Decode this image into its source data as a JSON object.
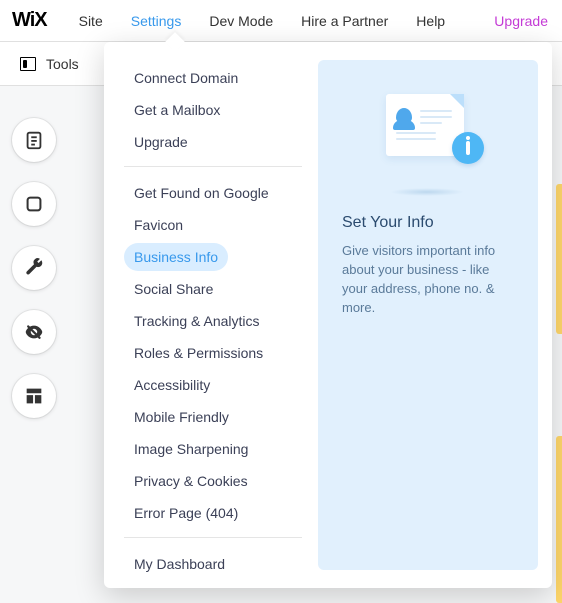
{
  "brand": "WiX",
  "topnav": {
    "site": "Site",
    "settings": "Settings",
    "devmode": "Dev Mode",
    "hire": "Hire a Partner",
    "help": "Help",
    "upgrade": "Upgrade"
  },
  "toolsbar": {
    "label": "Tools"
  },
  "settings_menu": {
    "group1": [
      {
        "key": "connect_domain",
        "label": "Connect Domain"
      },
      {
        "key": "get_mailbox",
        "label": "Get a Mailbox"
      },
      {
        "key": "upgrade",
        "label": "Upgrade"
      }
    ],
    "group2": [
      {
        "key": "get_found",
        "label": "Get Found on Google"
      },
      {
        "key": "favicon",
        "label": "Favicon"
      },
      {
        "key": "business_info",
        "label": "Business Info",
        "selected": true
      },
      {
        "key": "social_share",
        "label": "Social Share"
      },
      {
        "key": "tracking",
        "label": "Tracking & Analytics"
      },
      {
        "key": "roles",
        "label": "Roles & Permissions"
      },
      {
        "key": "accessibility",
        "label": "Accessibility"
      },
      {
        "key": "mobile",
        "label": "Mobile Friendly"
      },
      {
        "key": "sharpening",
        "label": "Image Sharpening"
      },
      {
        "key": "privacy",
        "label": "Privacy & Cookies"
      },
      {
        "key": "error_page",
        "label": "Error Page (404)"
      }
    ],
    "group3": [
      {
        "key": "dashboard",
        "label": "My Dashboard"
      }
    ]
  },
  "info_panel": {
    "title": "Set Your Info",
    "description": "Give visitors important info about your business - like your address, phone no. & more."
  }
}
